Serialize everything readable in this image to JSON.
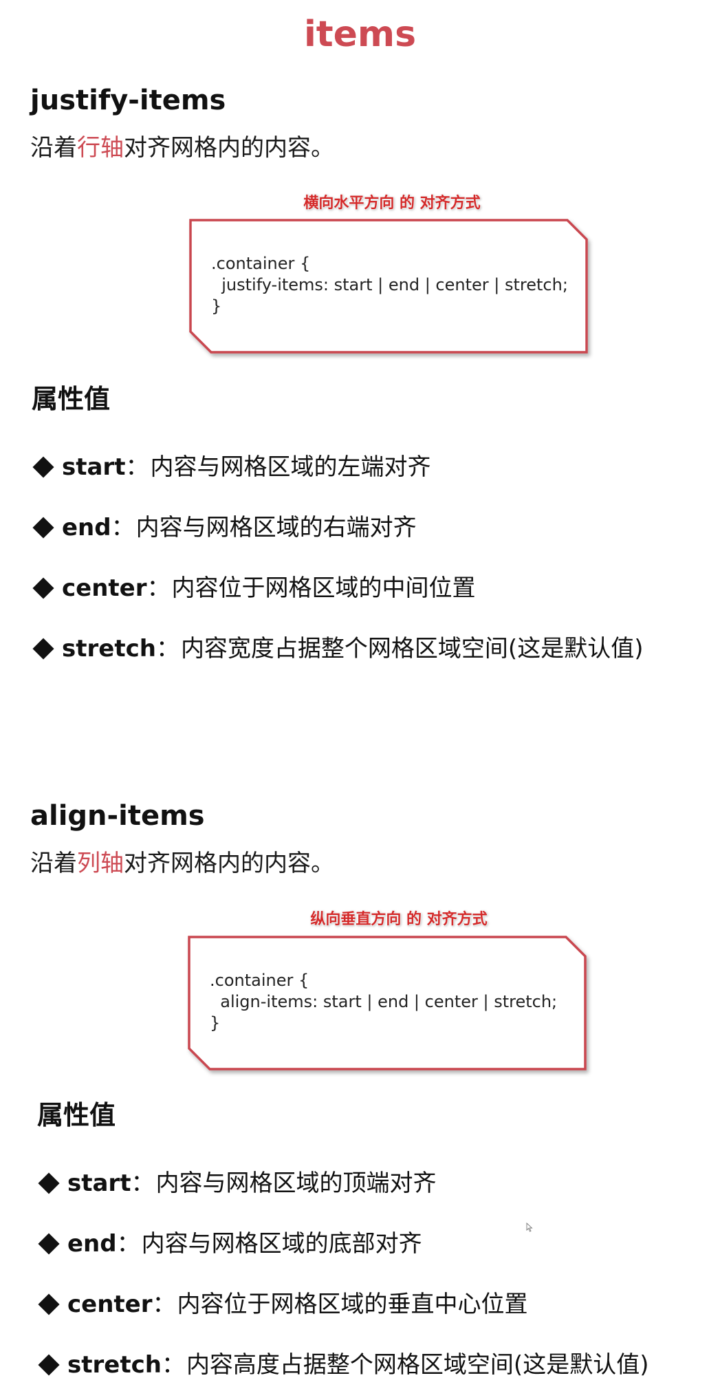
{
  "title": "items",
  "justify": {
    "heading": "justify-items",
    "desc_prefix": "沿着",
    "desc_highlight": "行轴",
    "desc_suffix": "对齐网格内的内容。",
    "annotation": "横向水平方向 的 对齐方式",
    "code": {
      "line1": ".container {",
      "line2": "  justify-items: start | end | center | stretch;",
      "line3": "}"
    },
    "props_heading": "属性值",
    "props": [
      {
        "key": "start",
        "sep": "：",
        "text": "内容与网格区域的左端对齐"
      },
      {
        "key": "end",
        "sep": "：",
        "text": "内容与网格区域的右端对齐"
      },
      {
        "key": "center",
        "sep": "：",
        "text": "内容位于网格区域的中间位置"
      },
      {
        "key": "stretch",
        "sep": "：",
        "text": "内容宽度占据整个网格区域空间(这是默认值)"
      }
    ]
  },
  "align": {
    "heading": "align-items",
    "desc_prefix": "沿着",
    "desc_highlight": "列轴",
    "desc_suffix": "对齐网格内的内容。",
    "annotation": "纵向垂直方向 的 对齐方式",
    "code": {
      "line1": ".container {",
      "line2": "  align-items: start | end | center | stretch;",
      "line3": "}"
    },
    "props_heading": "属性值",
    "props": [
      {
        "key": "start",
        "sep": "：",
        "text": "内容与网格区域的顶端对齐"
      },
      {
        "key": "end",
        "sep": "：",
        "text": "内容与网格区域的底部对齐"
      },
      {
        "key": "center",
        "sep": "：",
        "text": "内容位于网格区域的垂直中心位置"
      },
      {
        "key": "stretch",
        "sep": "：",
        "text": "内容高度占据整个网格区域空间(这是默认值)"
      }
    ]
  },
  "colors": {
    "accent": "#cd4a53",
    "annotation": "#d42a2a",
    "box_border": "#c9464f"
  }
}
